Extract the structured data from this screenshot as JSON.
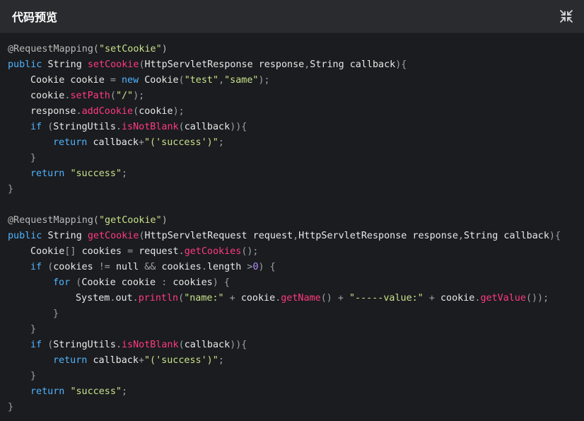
{
  "window": {
    "title": "代码预览",
    "collapse_icon": "collapse-arrows-icon"
  },
  "colors": {
    "background": "#1b1c1f",
    "header": "#2a2b2e",
    "keyword": "#4fb3ff",
    "method": "#ff3a7d",
    "string": "#c8e28b"
  },
  "code": {
    "language": "java",
    "lines": [
      {
        "indent": 0,
        "tokens": [
          {
            "t": "@RequestMapping(",
            "c": "ann"
          },
          {
            "t": "\"setCookie\"",
            "c": "str"
          },
          {
            "t": ")",
            "c": "ann"
          }
        ]
      },
      {
        "indent": 0,
        "tokens": [
          {
            "t": "public ",
            "c": "kw"
          },
          {
            "t": "String ",
            "c": "plain"
          },
          {
            "t": "setCookie",
            "c": "fn"
          },
          {
            "t": "(",
            "c": "punc"
          },
          {
            "t": "HttpServletResponse response",
            "c": "plain"
          },
          {
            "t": ",",
            "c": "punc"
          },
          {
            "t": "String callback",
            "c": "plain"
          },
          {
            "t": "){",
            "c": "punc"
          }
        ]
      },
      {
        "indent": 1,
        "tokens": [
          {
            "t": "Cookie cookie ",
            "c": "plain"
          },
          {
            "t": "= ",
            "c": "punc"
          },
          {
            "t": "new ",
            "c": "kw"
          },
          {
            "t": "Cookie",
            "c": "plain"
          },
          {
            "t": "(",
            "c": "punc"
          },
          {
            "t": "\"test\"",
            "c": "str"
          },
          {
            "t": ",",
            "c": "punc"
          },
          {
            "t": "\"same\"",
            "c": "str"
          },
          {
            "t": ");",
            "c": "punc"
          }
        ]
      },
      {
        "indent": 1,
        "tokens": [
          {
            "t": "cookie",
            "c": "plain"
          },
          {
            "t": ".",
            "c": "punc"
          },
          {
            "t": "setPath",
            "c": "fn"
          },
          {
            "t": "(",
            "c": "punc"
          },
          {
            "t": "\"/\"",
            "c": "str"
          },
          {
            "t": ");",
            "c": "punc"
          }
        ]
      },
      {
        "indent": 1,
        "tokens": [
          {
            "t": "response",
            "c": "plain"
          },
          {
            "t": ".",
            "c": "punc"
          },
          {
            "t": "addCookie",
            "c": "fn"
          },
          {
            "t": "(",
            "c": "punc"
          },
          {
            "t": "cookie",
            "c": "plain"
          },
          {
            "t": ");",
            "c": "punc"
          }
        ]
      },
      {
        "indent": 1,
        "tokens": [
          {
            "t": "if ",
            "c": "kw"
          },
          {
            "t": "(",
            "c": "punc"
          },
          {
            "t": "StringUtils",
            "c": "plain"
          },
          {
            "t": ".",
            "c": "punc"
          },
          {
            "t": "isNotBlank",
            "c": "fn"
          },
          {
            "t": "(",
            "c": "punc"
          },
          {
            "t": "callback",
            "c": "plain"
          },
          {
            "t": ")){",
            "c": "punc"
          }
        ]
      },
      {
        "indent": 2,
        "tokens": [
          {
            "t": "return ",
            "c": "kw"
          },
          {
            "t": "callback",
            "c": "plain"
          },
          {
            "t": "+",
            "c": "punc"
          },
          {
            "t": "\"('success')\"",
            "c": "str"
          },
          {
            "t": ";",
            "c": "punc"
          }
        ]
      },
      {
        "indent": 1,
        "tokens": [
          {
            "t": "}",
            "c": "punc"
          }
        ]
      },
      {
        "indent": 1,
        "tokens": [
          {
            "t": "return ",
            "c": "kw"
          },
          {
            "t": "\"success\"",
            "c": "str"
          },
          {
            "t": ";",
            "c": "punc"
          }
        ]
      },
      {
        "indent": 0,
        "tokens": [
          {
            "t": "}",
            "c": "punc"
          }
        ]
      },
      {
        "indent": 0,
        "tokens": []
      },
      {
        "indent": 0,
        "tokens": [
          {
            "t": "@RequestMapping(",
            "c": "ann"
          },
          {
            "t": "\"getCookie\"",
            "c": "str"
          },
          {
            "t": ")",
            "c": "ann"
          }
        ]
      },
      {
        "indent": 0,
        "tokens": [
          {
            "t": "public ",
            "c": "kw"
          },
          {
            "t": "String ",
            "c": "plain"
          },
          {
            "t": "getCookie",
            "c": "fn"
          },
          {
            "t": "(",
            "c": "punc"
          },
          {
            "t": "HttpServletRequest request",
            "c": "plain"
          },
          {
            "t": ",",
            "c": "punc"
          },
          {
            "t": "HttpServletResponse response",
            "c": "plain"
          },
          {
            "t": ",",
            "c": "punc"
          },
          {
            "t": "String callback",
            "c": "plain"
          },
          {
            "t": "){",
            "c": "punc"
          }
        ]
      },
      {
        "indent": 1,
        "tokens": [
          {
            "t": "Cookie",
            "c": "plain"
          },
          {
            "t": "[] ",
            "c": "punc"
          },
          {
            "t": "cookies ",
            "c": "plain"
          },
          {
            "t": "= ",
            "c": "punc"
          },
          {
            "t": "request",
            "c": "plain"
          },
          {
            "t": ".",
            "c": "punc"
          },
          {
            "t": "getCookies",
            "c": "fn"
          },
          {
            "t": "();",
            "c": "punc"
          }
        ]
      },
      {
        "indent": 1,
        "tokens": [
          {
            "t": "if ",
            "c": "kw"
          },
          {
            "t": "(",
            "c": "punc"
          },
          {
            "t": "cookies ",
            "c": "plain"
          },
          {
            "t": "!= ",
            "c": "punc"
          },
          {
            "t": "null ",
            "c": "plain"
          },
          {
            "t": "&& ",
            "c": "punc"
          },
          {
            "t": "cookies",
            "c": "plain"
          },
          {
            "t": ".",
            "c": "punc"
          },
          {
            "t": "length ",
            "c": "plain"
          },
          {
            "t": ">",
            "c": "punc"
          },
          {
            "t": "0",
            "c": "op"
          },
          {
            "t": ") {",
            "c": "punc"
          }
        ]
      },
      {
        "indent": 2,
        "tokens": [
          {
            "t": "for ",
            "c": "kw"
          },
          {
            "t": "(",
            "c": "punc"
          },
          {
            "t": "Cookie cookie ",
            "c": "plain"
          },
          {
            "t": ": ",
            "c": "punc"
          },
          {
            "t": "cookies",
            "c": "plain"
          },
          {
            "t": ") {",
            "c": "punc"
          }
        ]
      },
      {
        "indent": 3,
        "tokens": [
          {
            "t": "System",
            "c": "plain"
          },
          {
            "t": ".",
            "c": "punc"
          },
          {
            "t": "out",
            "c": "plain"
          },
          {
            "t": ".",
            "c": "punc"
          },
          {
            "t": "println",
            "c": "fn"
          },
          {
            "t": "(",
            "c": "punc"
          },
          {
            "t": "\"name:\"",
            "c": "str"
          },
          {
            "t": " + ",
            "c": "punc"
          },
          {
            "t": "cookie",
            "c": "plain"
          },
          {
            "t": ".",
            "c": "punc"
          },
          {
            "t": "getName",
            "c": "fn"
          },
          {
            "t": "()",
            "c": "punc"
          },
          {
            "t": " + ",
            "c": "punc"
          },
          {
            "t": "\"-----value:\"",
            "c": "str"
          },
          {
            "t": " + ",
            "c": "punc"
          },
          {
            "t": "cookie",
            "c": "plain"
          },
          {
            "t": ".",
            "c": "punc"
          },
          {
            "t": "getValue",
            "c": "fn"
          },
          {
            "t": "());",
            "c": "punc"
          }
        ]
      },
      {
        "indent": 2,
        "tokens": [
          {
            "t": "}",
            "c": "punc"
          }
        ]
      },
      {
        "indent": 1,
        "tokens": [
          {
            "t": "}",
            "c": "punc"
          }
        ]
      },
      {
        "indent": 1,
        "tokens": [
          {
            "t": "if ",
            "c": "kw"
          },
          {
            "t": "(",
            "c": "punc"
          },
          {
            "t": "StringUtils",
            "c": "plain"
          },
          {
            "t": ".",
            "c": "punc"
          },
          {
            "t": "isNotBlank",
            "c": "fn"
          },
          {
            "t": "(",
            "c": "punc"
          },
          {
            "t": "callback",
            "c": "plain"
          },
          {
            "t": ")){",
            "c": "punc"
          }
        ]
      },
      {
        "indent": 2,
        "tokens": [
          {
            "t": "return ",
            "c": "kw"
          },
          {
            "t": "callback",
            "c": "plain"
          },
          {
            "t": "+",
            "c": "punc"
          },
          {
            "t": "\"('success')\"",
            "c": "str"
          },
          {
            "t": ";",
            "c": "punc"
          }
        ]
      },
      {
        "indent": 1,
        "tokens": [
          {
            "t": "}",
            "c": "punc"
          }
        ]
      },
      {
        "indent": 1,
        "tokens": [
          {
            "t": "return ",
            "c": "kw"
          },
          {
            "t": "\"success\"",
            "c": "str"
          },
          {
            "t": ";",
            "c": "punc"
          }
        ]
      },
      {
        "indent": 0,
        "tokens": [
          {
            "t": "}",
            "c": "punc"
          }
        ]
      }
    ]
  }
}
